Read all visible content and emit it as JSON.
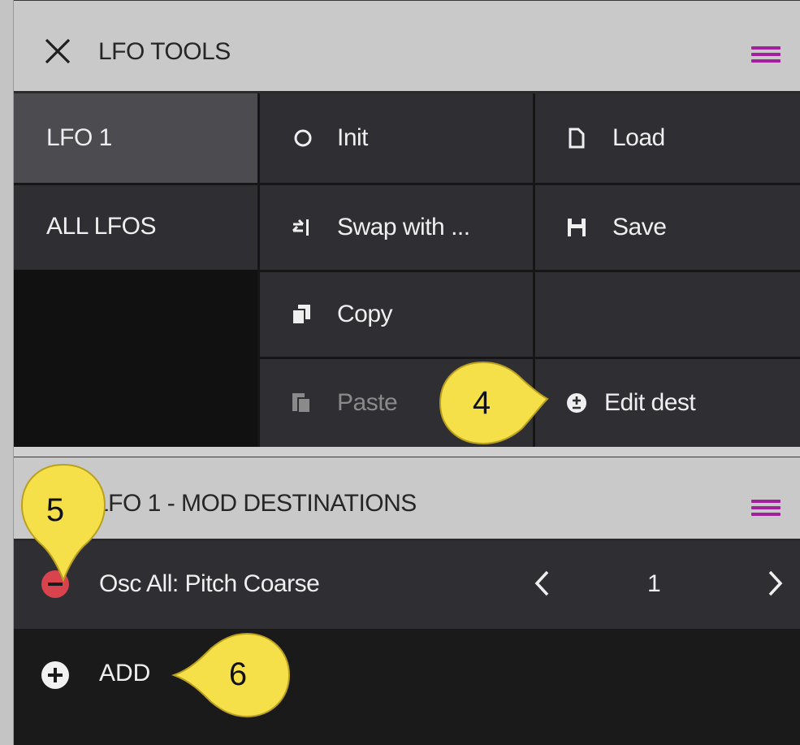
{
  "tools_panel": {
    "title": "LFO TOOLS",
    "tabs": [
      {
        "label": "LFO 1",
        "selected": true
      },
      {
        "label": "ALL LFOS",
        "selected": false
      }
    ],
    "actions": {
      "init": "Init",
      "load": "Load",
      "swap": "Swap with ...",
      "save": "Save",
      "copy": "Copy",
      "paste": "Paste",
      "edit_dest": "Edit dest"
    },
    "paste_disabled": true
  },
  "dest_panel": {
    "title": "LFO 1 - MOD DESTINATIONS",
    "destinations": [
      {
        "label": "Osc All: Pitch Coarse",
        "index": "1"
      }
    ],
    "add_label": "ADD"
  },
  "callouts": {
    "c4": "4",
    "c5": "5",
    "c6": "6"
  },
  "colors": {
    "accent": "#a1209c",
    "remove": "#d9434d",
    "callout": "#f5e04a"
  }
}
